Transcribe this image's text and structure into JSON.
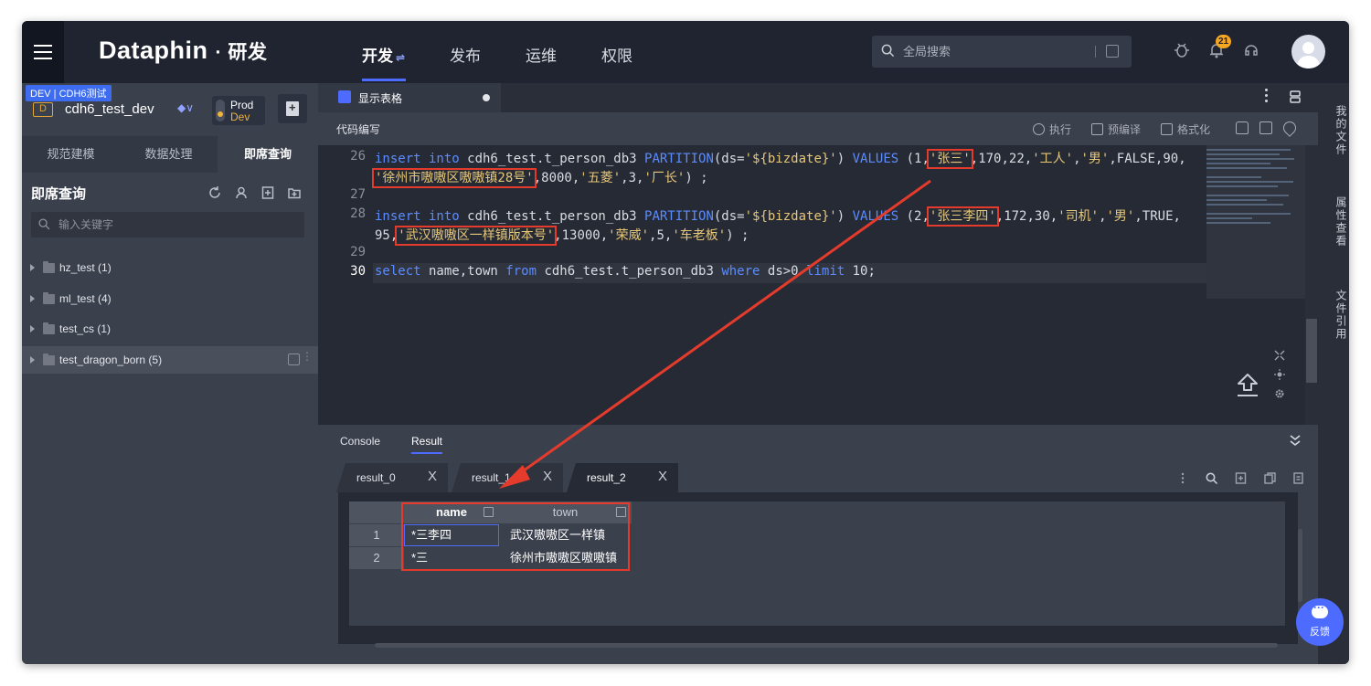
{
  "app": {
    "brand": "Dataphin",
    "brand_sub": "· 研发",
    "nav_tabs": [
      "开发",
      "发布",
      "运维",
      "权限"
    ],
    "nav_switch_glyph": "⇌",
    "search_placeholder": "全局搜索",
    "notification_count": "21"
  },
  "left": {
    "env_badge": "DEV | CDH6测试",
    "project_letter": "D",
    "project_name": "cdh6_test_dev",
    "toggle_prod": "Prod",
    "toggle_dev": "Dev",
    "tabs": [
      "规范建模",
      "数据处理",
      "即席查询"
    ],
    "panel_title": "即席查询",
    "kw_placeholder": "输入关键字",
    "tree": [
      {
        "label": "hz_test (1)"
      },
      {
        "label": "ml_test (4)"
      },
      {
        "label": "test_cs (1)"
      },
      {
        "label": "test_dragon_born (5)"
      }
    ]
  },
  "editor": {
    "file_tab": "显示表格",
    "toolbar_title": "代码编写",
    "toolbar_buttons": [
      "执行",
      "预编译",
      "格式化"
    ],
    "line_numbers": [
      "26",
      "27",
      "28",
      "29",
      "30"
    ],
    "code": {
      "l26a_kw1": "insert into",
      "l26a_t1": " cdh6_test.t_person_db3 ",
      "l26a_kw2": "PARTITION",
      "l26a_t2": "(ds=",
      "l26a_s1": "'${bizdate}'",
      "l26a_t3": ") ",
      "l26a_kw3": "VALUES",
      "l26a_t4": " (1,",
      "l26a_s2": "'张三'",
      "l26a_t5": ",170,22,",
      "l26a_s3": "'工人'",
      "l26a_t6": ",",
      "l26a_s4": "'男'",
      "l26a_t7": ",FALSE,90,",
      "l26b_s1": "'徐州市嗷嗷区嗷嗷镇28号'",
      "l26b_t1": ",8000,",
      "l26b_s2": "'五菱'",
      "l26b_t2": ",3,",
      "l26b_s3": "'厂长'",
      "l26b_t3": ") ;",
      "l28a_kw1": "insert into",
      "l28a_t1": " cdh6_test.t_person_db3 ",
      "l28a_kw2": "PARTITION",
      "l28a_t2": "(ds=",
      "l28a_s1": "'${bizdate}'",
      "l28a_t3": ") ",
      "l28a_kw3": "VALUES",
      "l28a_t4": " (2,",
      "l28a_s2": "'张三李四'",
      "l28a_t5": ",172,30,",
      "l28a_s3": "'司机'",
      "l28a_t6": ",",
      "l28a_s4": "'男'",
      "l28a_t7": ",TRUE,",
      "l28b_t0": "95,",
      "l28b_s1": "'武汉嗷嗷区一样镇版本号'",
      "l28b_t1": ",13000,",
      "l28b_s2": "'荣威'",
      "l28b_t2": ",5,",
      "l28b_s3": "'车老板'",
      "l28b_t3": ") ;",
      "l30_kw1": "select",
      "l30_t1": " name,town ",
      "l30_kw2": "from",
      "l30_t2": " cdh6_test.t_person_db3 ",
      "l30_kw3": "where",
      "l30_t3": " ds>0 ",
      "l30_kw4": "limit",
      "l30_t4": " 10;"
    }
  },
  "result": {
    "panel_tabs": [
      "Console",
      "Result"
    ],
    "result_tabs": [
      "result_0",
      "result_1",
      "result_2"
    ],
    "close_glyph": "X",
    "columns": [
      "name",
      "town"
    ],
    "rows": [
      {
        "num": "1",
        "name": "*三李四",
        "town": "武汉嗷嗷区一样镇"
      },
      {
        "num": "2",
        "name": "*三",
        "town": "徐州市嗷嗷区嗷嗷镇"
      }
    ]
  },
  "rightbar": [
    "我的文件",
    "属性查看",
    "文件引用"
  ],
  "feedback": "反馈",
  "colors": {
    "accent": "#4d6bff",
    "highlight_box": "#e53b2c",
    "keyword": "#5b8cff",
    "string": "#e6c77a"
  }
}
